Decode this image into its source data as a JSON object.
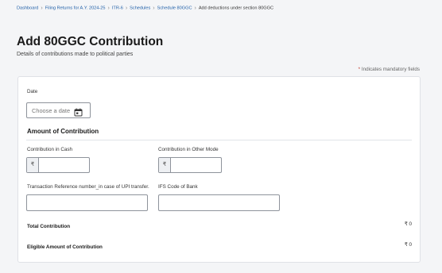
{
  "breadcrumb": [
    {
      "label": "Dashboard"
    },
    {
      "label": "Filing Returns for A.Y. 2024-25"
    },
    {
      "label": "ITR-6"
    },
    {
      "label": "Schedules"
    },
    {
      "label": "Schedule 80GGC"
    },
    {
      "label": "Add deductions under section 80GGC"
    }
  ],
  "breadcrumb_separator": "›",
  "page": {
    "title": "Add 80GGC Contribution",
    "subtitle": "Details of contributions made to political parties"
  },
  "mandatory_note": {
    "star": "*",
    "text": "Indicates mandatory fields"
  },
  "form": {
    "date": {
      "label": "Date",
      "placeholder": "Choose a date",
      "icon": "calendar-icon"
    },
    "amount_section": {
      "heading": "Amount of Contribution"
    },
    "cash": {
      "label": "Contribution in Cash",
      "currency": "₹",
      "value": ""
    },
    "other_mode": {
      "label": "Contribution in Other Mode",
      "currency": "₹",
      "value": ""
    },
    "upi_ref": {
      "label": "Transaction Reference number_in case of UPI transfer.",
      "value": ""
    },
    "ifsc": {
      "label": "IFS Code of Bank",
      "value": ""
    },
    "total": {
      "label": "Total Contribution",
      "value": "₹ 0"
    },
    "eligible": {
      "label": "Eligible Amount of Contribution",
      "value": "₹ 0"
    }
  },
  "colors": {
    "link": "#1f5fa8",
    "mandatory_star": "#c0392b",
    "border": "#8e939b"
  }
}
